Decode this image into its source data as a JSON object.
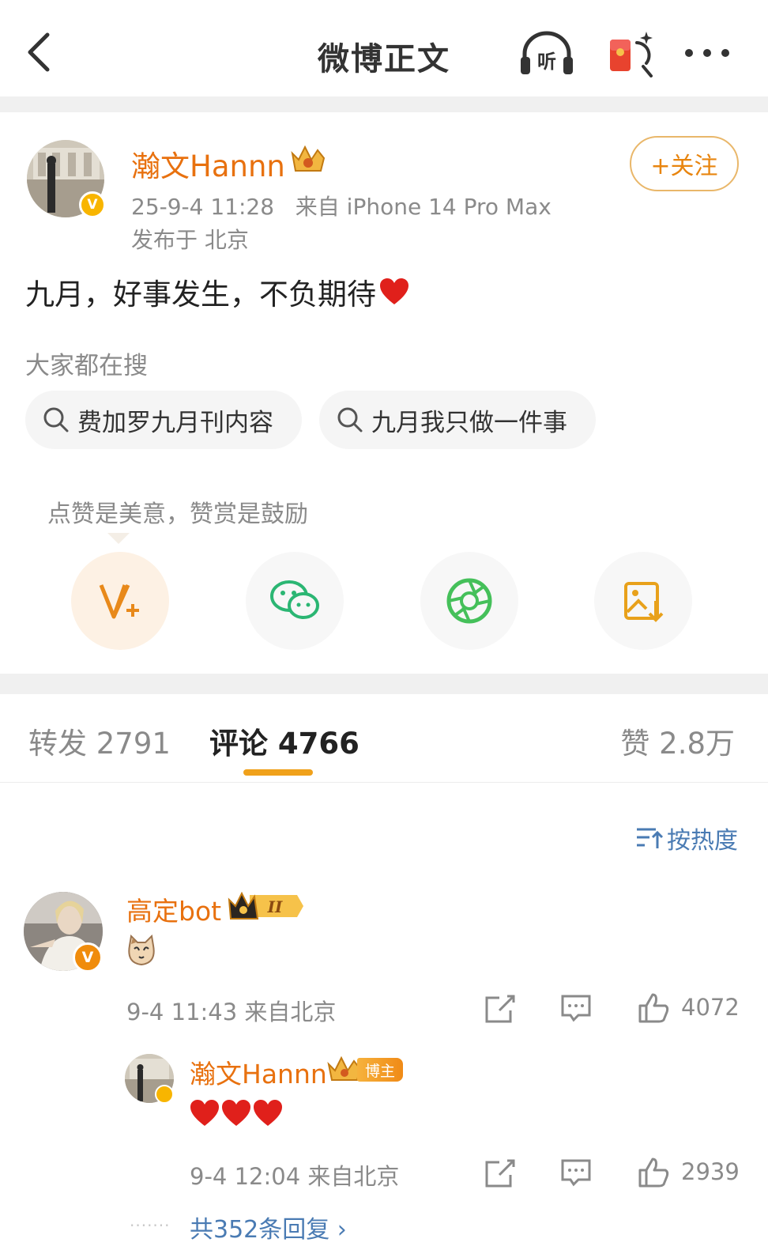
{
  "header": {
    "title": "微博正文",
    "listen_label": "听"
  },
  "post": {
    "author": "瀚文Hannn",
    "meta": "25-9-4 11:28   来自 iPhone 14 Pro Max",
    "location": "发布于 北京",
    "follow_label": "+关注",
    "text": "九月，好事发生，不负期待",
    "verified_mark": "V"
  },
  "searches": {
    "heading": "大家都在搜",
    "items": [
      "费加罗九月刊内容",
      "九月我只做一件事"
    ]
  },
  "tip": "点赞是美意，赞赏是鼓励",
  "share_icons": [
    "reward-icon",
    "wechat-icon",
    "moments-icon",
    "save-image-icon"
  ],
  "tabs": {
    "repost": "转发 2791",
    "comment": "评论 4766",
    "like": "赞 2.8万"
  },
  "sort_label": "按热度",
  "comments": [
    {
      "name": "高定bot",
      "level_badge": "II",
      "meta": "9-4 11:43 来自北京",
      "likes": "4072",
      "verified_mark": "V",
      "reply": {
        "name": "瀚文Hannn",
        "tag": "博主",
        "meta": "9-4 12:04 来自北京",
        "likes": "2939"
      },
      "more_replies": "共352条回复 ›"
    }
  ],
  "colors": {
    "accent": "#e8710f",
    "link": "#4a7bb3",
    "underline": "#f0a11b"
  }
}
